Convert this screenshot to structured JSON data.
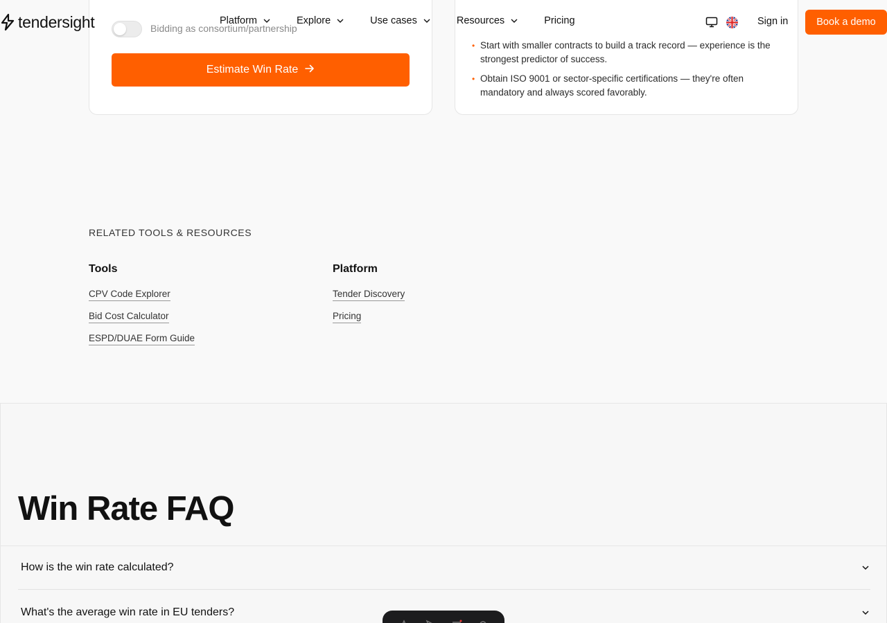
{
  "header": {
    "logo_text": "tendersight",
    "nav": [
      {
        "label": "Platform",
        "has_dropdown": true
      },
      {
        "label": "Explore",
        "has_dropdown": true
      },
      {
        "label": "Use cases",
        "has_dropdown": true
      },
      {
        "label": "Resources",
        "has_dropdown": true
      },
      {
        "label": "Pricing",
        "has_dropdown": false
      }
    ],
    "icons": [
      "monitor-icon",
      "uk-flag-icon"
    ],
    "sign_in": "Sign in",
    "book_demo": "Book a demo"
  },
  "calculator": {
    "toggle_label": "Bidding as consortium/partnership",
    "toggle_on": false,
    "estimate_button": "Estimate Win Rate",
    "tips": [
      "Start with smaller contracts to build a track record — experience is the strongest predictor of success.",
      "Obtain ISO 9001 or sector-specific certifications — they're often mandatory and always scored favorably."
    ]
  },
  "related": {
    "heading": "RELATED TOOLS & RESOURCES",
    "tools": {
      "title": "Tools",
      "links": [
        "CPV Code Explorer",
        "Bid Cost Calculator",
        "ESPD/DUAE Form Guide"
      ]
    },
    "platform": {
      "title": "Platform",
      "links": [
        "Tender Discovery",
        "Pricing"
      ]
    }
  },
  "faq": {
    "title": "Win Rate FAQ",
    "questions": [
      "How is the win rate calculated?",
      "What's the average win rate in EU tenders?"
    ]
  },
  "colors": {
    "accent": "#ff5f00",
    "background": "#f9f9f9",
    "text": "#111111"
  }
}
